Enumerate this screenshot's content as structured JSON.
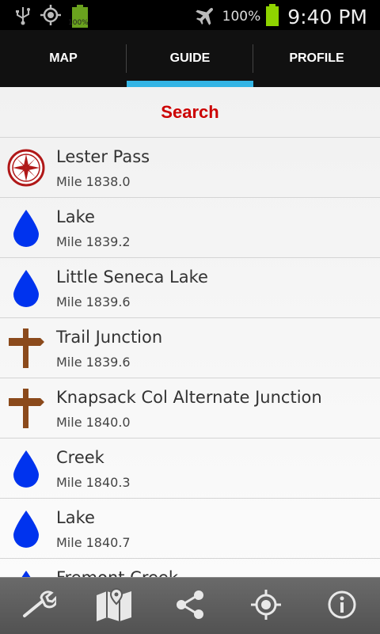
{
  "statusbar": {
    "battery_small_label": "100%",
    "battery_pct": "100%",
    "time": "9:40 PM"
  },
  "tabs": [
    {
      "label": "MAP",
      "active": false
    },
    {
      "label": "GUIDE",
      "active": true
    },
    {
      "label": "PROFILE",
      "active": false
    }
  ],
  "search": {
    "label": "Search"
  },
  "items": [
    {
      "name": "Lester Pass",
      "mile": "Mile 1838.0",
      "icon": "compass-rose-icon"
    },
    {
      "name": "Lake",
      "mile": "Mile 1839.2",
      "icon": "water-drop-icon"
    },
    {
      "name": "Little Seneca Lake",
      "mile": "Mile 1839.6",
      "icon": "water-drop-icon"
    },
    {
      "name": "Trail Junction",
      "mile": "Mile 1839.6",
      "icon": "signpost-icon"
    },
    {
      "name": "Knapsack Col Alternate Junction",
      "mile": "Mile 1840.0",
      "icon": "signpost-icon"
    },
    {
      "name": "Creek",
      "mile": "Mile 1840.3",
      "icon": "water-drop-icon"
    },
    {
      "name": "Lake",
      "mile": "Mile 1840.7",
      "icon": "water-drop-icon"
    },
    {
      "name": "Fremont Creek",
      "mile": "",
      "icon": "water-drop-icon"
    }
  ],
  "bottombar": [
    {
      "icon": "wrench-icon"
    },
    {
      "icon": "map-icon"
    },
    {
      "icon": "share-icon"
    },
    {
      "icon": "locate-icon"
    },
    {
      "icon": "info-icon"
    }
  ],
  "colors": {
    "accent": "#33b5e5",
    "search": "#cc0000",
    "water": "#0033ee",
    "signpost": "#8b4a1c",
    "compass": "#b01818"
  }
}
